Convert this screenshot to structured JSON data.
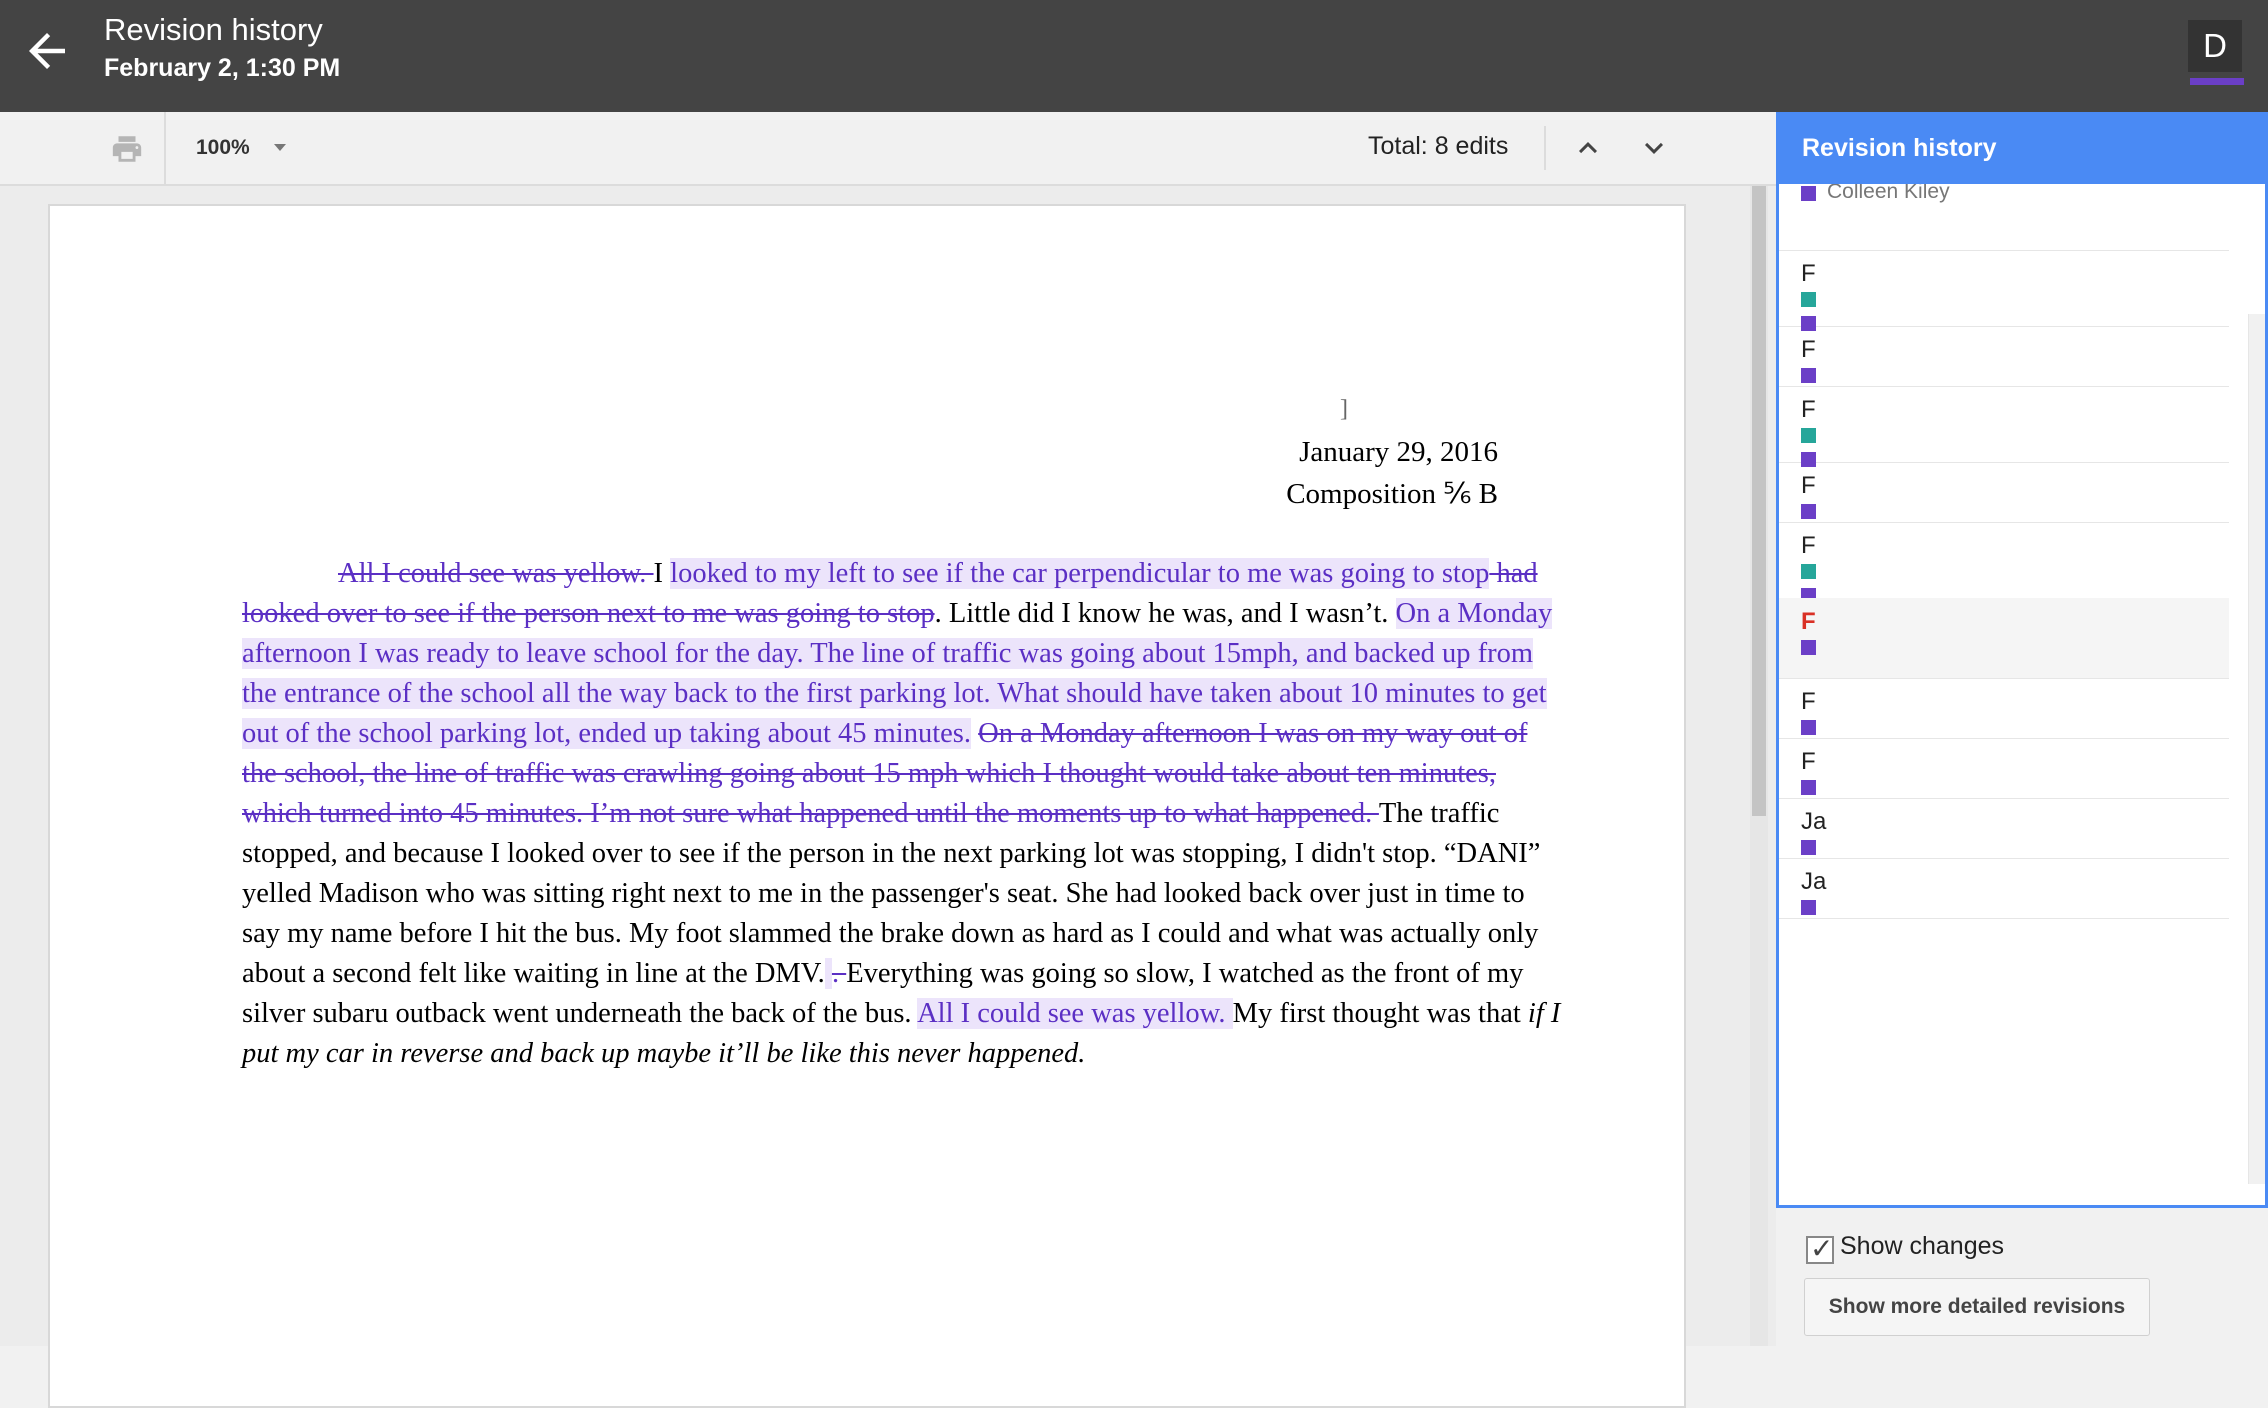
{
  "topbar": {
    "title": "Revision history",
    "date": "February 2, 1:30 PM",
    "avatar_letter": "D"
  },
  "toolbar": {
    "zoom": "100%",
    "total_edits": "Total: 8 edits"
  },
  "document": {
    "cursor_mark": "]",
    "header_date": "January 29, 2016",
    "header_class": "Composition ⅚ B",
    "segments": [
      {
        "kind": "del",
        "text": "All I could see was yellow. "
      },
      {
        "kind": "plain",
        "text": "I "
      },
      {
        "kind": "ins",
        "text": "looked to my left to see if the car perpendicular to me was going to stop"
      },
      {
        "kind": "del",
        "text": " had looked over to see if the person next to me was going to stop"
      },
      {
        "kind": "plain",
        "text": ". Little did I know he was, and I wasn’t. "
      },
      {
        "kind": "ins",
        "text": "On a Monday afternoon I was ready to leave school for the day. The line of traffic was going about 15mph, and backed up from the entrance of the school all the way back to the first parking lot. What should have taken about 10 minutes to get out of the school parking lot, ended up taking about 45 minutes."
      },
      {
        "kind": "plain",
        "text": " "
      },
      {
        "kind": "del",
        "text": "On a Monday afternoon I was on my way out of the school, the line of traffic was crawling going about 15 mph which I thought would take about ten minutes, which turned into 45 minutes. I’m not sure what happened until the moments up to what happened. "
      },
      {
        "kind": "plain",
        "text": "The traffic stopped, and because I looked over to see if the person in the next parking lot was stopping, I didn't stop. “DANI” yelled Madison who was sitting right next to me in the passenger's seat. She had looked back over just in time to say my name before I hit the bus. My foot slammed the brake down as hard as I could and what was actually only about a second felt like waiting in line at the DMV."
      },
      {
        "kind": "ins",
        "text": " "
      },
      {
        "kind": "del",
        "text": " . "
      },
      {
        "kind": "plain",
        "text": "Everything was going so slow, I watched as the front of my silver subaru outback went underneath the back of the bus. "
      },
      {
        "kind": "ins",
        "text": "All I could see was yellow. "
      },
      {
        "kind": "plain",
        "text": "My first thought was that "
      },
      {
        "kind": "ital",
        "text": "if I put my car in reverse and back up maybe it’ll be like this never happened."
      }
    ]
  },
  "panel": {
    "header": "Revision history",
    "items": [
      {
        "title": "",
        "author": "Colleen Kiley",
        "squares": [
          "purple"
        ],
        "selected": false
      },
      {
        "title": "F",
        "author": "",
        "squares": [
          "teal",
          "purple"
        ],
        "selected": false
      },
      {
        "title": "F",
        "author": "",
        "squares": [
          "purple"
        ],
        "selected": false
      },
      {
        "title": "F",
        "author": "",
        "squares": [
          "teal",
          "purple"
        ],
        "selected": false
      },
      {
        "title": "F",
        "author": "",
        "squares": [
          "purple"
        ],
        "selected": false
      },
      {
        "title": "F",
        "author": "",
        "squares": [
          "teal",
          "purple"
        ],
        "selected": false
      },
      {
        "title": "F",
        "author": "",
        "squares": [
          "purple"
        ],
        "selected": true
      },
      {
        "title": "F",
        "author": "",
        "squares": [
          "purple"
        ],
        "selected": false
      },
      {
        "title": "F",
        "author": "",
        "squares": [
          "purple"
        ],
        "selected": false
      },
      {
        "title": "Ja",
        "author": "",
        "squares": [
          "purple"
        ],
        "selected": false
      },
      {
        "title": "Ja",
        "author": "",
        "squares": [
          "purple"
        ],
        "selected": false
      }
    ],
    "show_changes_label": "Show changes",
    "show_changes_checked": true,
    "more_button": "Show more detailed revisions"
  },
  "colors": {
    "topbar": "#444444",
    "panel_accent": "#4a8af4",
    "purple": "#6b3fc7",
    "teal": "#26a69a",
    "selected_title": "#d93025"
  }
}
